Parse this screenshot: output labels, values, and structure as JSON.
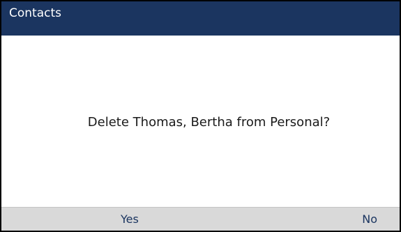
{
  "header": {
    "title": "Contacts"
  },
  "dialog": {
    "message": "Delete Thomas, Bertha from Personal?"
  },
  "softkeys": {
    "yes_label": "Yes",
    "no_label": "No"
  },
  "colors": {
    "header_bg": "#1b3560",
    "header_text": "#ffffff",
    "softkey_bar_bg": "#d9d9d9",
    "softkey_text": "#1b3560"
  }
}
